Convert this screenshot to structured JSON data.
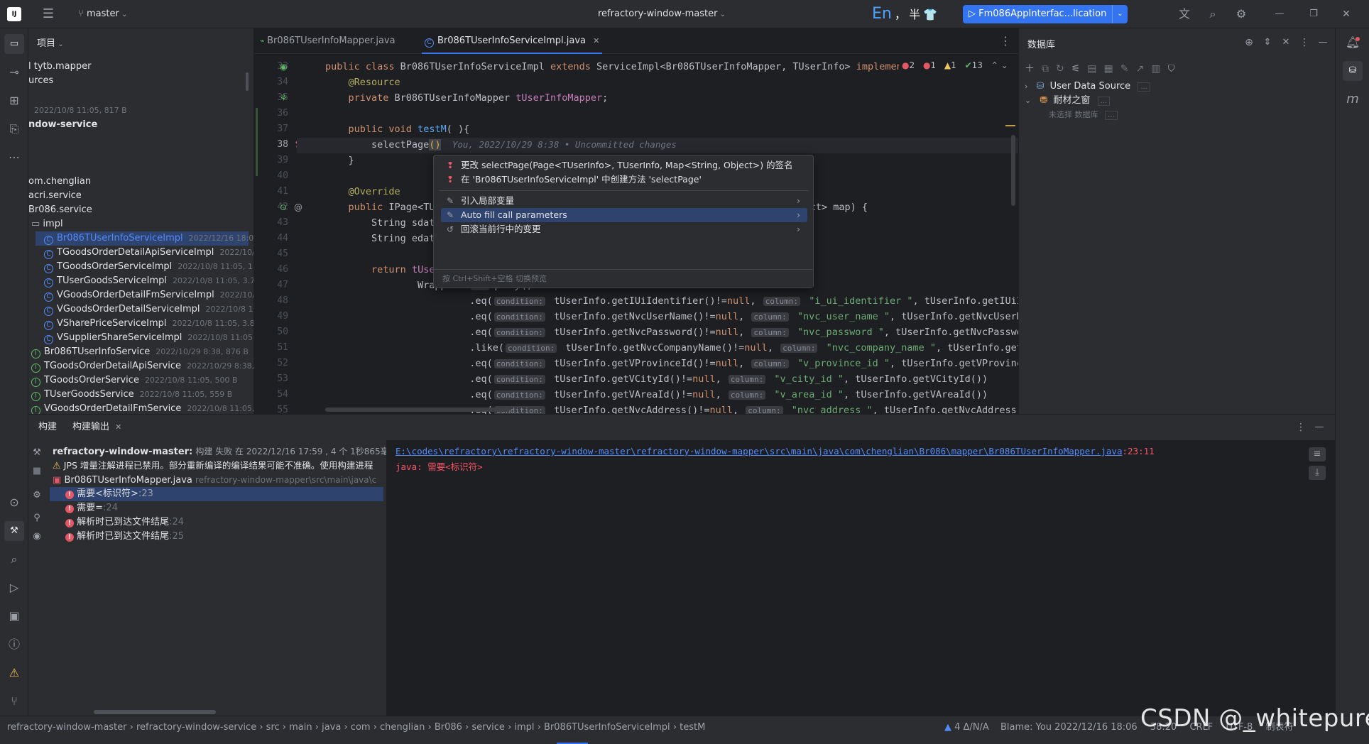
{
  "topbar": {
    "branch": "master",
    "project_title": "refractory-window-master",
    "ime_lang": "En",
    "ime_punct": "，",
    "ime_width": "半",
    "run_config": "Fm086AppInterfac...lication"
  },
  "project_panel": {
    "title": "项目",
    "rows": [
      {
        "text": "l tytb.mapper",
        "meta": ""
      },
      {
        "text": "urces",
        "meta": ""
      },
      {
        "text": "",
        "meta": "2022/10/8 11:05, 817 B"
      },
      {
        "text": "ndow-service",
        "meta": ""
      },
      {
        "text": "om.chenglian",
        "meta": ""
      },
      {
        "text": "acri.service",
        "meta": ""
      },
      {
        "text": "Br086.service",
        "meta": ""
      },
      {
        "text": "impl",
        "meta": ""
      },
      {
        "text": "Br086TUserInfoServiceImpl",
        "meta": "2022/12/16 18:06,"
      },
      {
        "text": "TGoodsOrderDetailApiServiceImpl",
        "meta": "2022/10/2"
      },
      {
        "text": "TGoodsOrderServiceImpl",
        "meta": "2022/10/8 11:05, 1.59"
      },
      {
        "text": "TUserGoodsServiceImpl",
        "meta": "2022/10/8 11:05, 3.7 k"
      },
      {
        "text": "VGoodsOrderDetailFmServiceImpl",
        "meta": "2022/10/8"
      },
      {
        "text": "VGoodsOrderDetailServiceImpl",
        "meta": "2022/10/8 11:0"
      },
      {
        "text": "VSharePriceServiceImpl",
        "meta": "2022/10/8 11:05, 3.87 k"
      },
      {
        "text": "VSupplierShareServiceImpl",
        "meta": "2022/10/8 11:05, 1."
      },
      {
        "text": "Br086TUserInfoService",
        "meta": "2022/10/29 8:38, 876 B"
      },
      {
        "text": "TGoodsOrderDetailApiService",
        "meta": "2022/10/29 8:38, 1"
      },
      {
        "text": "TGoodsOrderService",
        "meta": "2022/10/8 11:05, 500 B"
      },
      {
        "text": "TUserGoodsService",
        "meta": "2022/10/8 11:05, 559 B"
      },
      {
        "text": "VGoodsOrderDetailFmService",
        "meta": "2022/10/8 11:05, 1."
      }
    ]
  },
  "editor": {
    "tabs": [
      {
        "label": "Br086TUserInfoMapper.java"
      },
      {
        "label": "Br086TUserInfoServiceImpl.java"
      }
    ],
    "inspection": {
      "errors": "2",
      "warnings_red": "1",
      "warnings": "1",
      "checks": "13"
    },
    "lines": [
      {
        "num": "33"
      },
      {
        "num": "34"
      },
      {
        "num": "35"
      },
      {
        "num": "36"
      },
      {
        "num": "37"
      },
      {
        "num": "38"
      },
      {
        "num": "39"
      },
      {
        "num": "40"
      },
      {
        "num": "41"
      },
      {
        "num": "42"
      },
      {
        "num": "43"
      },
      {
        "num": "44"
      },
      {
        "num": "45"
      },
      {
        "num": "46"
      },
      {
        "num": "47"
      },
      {
        "num": "48"
      },
      {
        "num": "49"
      },
      {
        "num": "50"
      },
      {
        "num": "51"
      },
      {
        "num": "52"
      },
      {
        "num": "53"
      },
      {
        "num": "54"
      },
      {
        "num": "55"
      }
    ],
    "blame_hint": "You, 2022/10/29 8:38 • Uncommitted changes"
  },
  "context_menu": {
    "items": [
      {
        "label": "更改 selectPage(Page<TUserInfo>, TUserInfo, Map<String, Object>) 的签名"
      },
      {
        "label": "在 'Br086TUserInfoServiceImpl' 中创建方法 'selectPage'"
      },
      {
        "label": "引入局部变量"
      },
      {
        "label": "Auto fill call parameters"
      },
      {
        "label": "回滚当前行中的变更"
      }
    ],
    "footer": "按 Ctrl+Shift+空格 切换预览"
  },
  "db_panel": {
    "title": "数据库",
    "items": [
      {
        "label": "User Data Source",
        "badge": "..."
      },
      {
        "label": "耐材之窗",
        "badge": "..."
      },
      {
        "label": "未选择 数据库",
        "badge": "..."
      }
    ]
  },
  "build_panel": {
    "tabs": [
      {
        "label": "构建"
      },
      {
        "label": "构建输出"
      }
    ],
    "header_project": "refractory-window-master:",
    "header_status": "构建 失败 在 2022/12/16 17:59 , 4 个 1秒865毫秒",
    "warning": "JPS 增量注解进程已禁用。部分重新编译的编译结果可能不准确。使用构建进程",
    "file": "Br086TUserInfoMapper.java",
    "file_path": "refractory-window-mapper\\src\\main\\java\\c",
    "errors": [
      {
        "msg": "需要<标识符>",
        "line": ":23"
      },
      {
        "msg": "需要=",
        "line": ":24"
      },
      {
        "msg": "解析时已到达文件结尾",
        "line": ":24"
      },
      {
        "msg": "解析时已到达文件结尾",
        "line": ":25"
      }
    ],
    "output_link": "E:\\codes\\refractory\\refractory-window-master\\refractory-window-mapper\\src\\main\\java\\com\\chenglian\\Br086\\mapper\\Br086TUserInfoMapper.java",
    "output_pos": ":23:11",
    "output_msg": "java: 需要<标识符>"
  },
  "statusbar": {
    "breadcrumb": [
      "refractory-window-master",
      "refractory-window-service",
      "src",
      "main",
      "java",
      "com",
      "chenglian",
      "Br086",
      "service",
      "impl",
      "Br086TUserInfoServiceImpl",
      "testM"
    ],
    "vcs": "4 Δ/N/A",
    "blame": "Blame: You 2022/12/16 18:06",
    "position": "38:20",
    "line_sep": "CRLF",
    "encoding": "UTF-8",
    "indent": "制表符"
  },
  "watermark": "CSDN @_whitepure"
}
